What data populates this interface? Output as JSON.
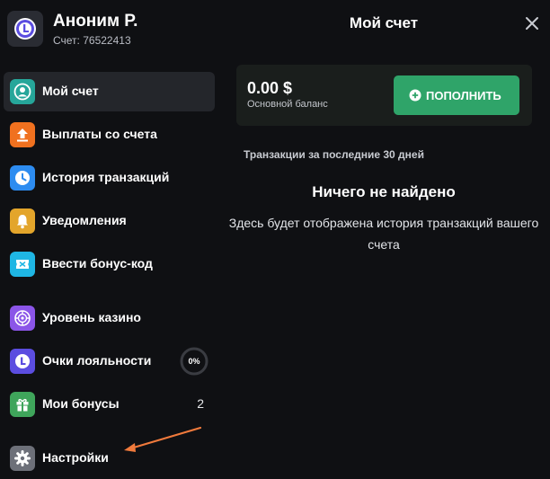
{
  "profile": {
    "name": "Аноним Р.",
    "account_label": "Счет: 76522413"
  },
  "sidebar": {
    "items": [
      {
        "label": "Мой счет",
        "icon": "user-circle-icon",
        "active": true,
        "color": "#26a69a"
      },
      {
        "label": "Выплаты со счета",
        "icon": "upload-icon",
        "color": "#f0711f"
      },
      {
        "label": "История транзакций",
        "icon": "clock-icon",
        "color": "#2d8cf0"
      },
      {
        "label": "Уведомления",
        "icon": "bell-icon",
        "color": "#e3a52b"
      },
      {
        "label": "Ввести бонус-код",
        "icon": "ticket-icon",
        "color": "#1fb6e4"
      },
      {
        "label": "Уровень казино",
        "icon": "roulette-icon",
        "color": "#8b55e8"
      },
      {
        "label": "Очки лояльности",
        "icon": "loyalty-icon",
        "color": "#5b4de0",
        "progress_text": "0%",
        "progress": 0
      },
      {
        "label": "Мои бонусы",
        "icon": "gift-icon",
        "color": "#3fa55b",
        "badge": "2"
      },
      {
        "label": "Настройки",
        "icon": "gear-icon",
        "color": "#6d7079"
      }
    ]
  },
  "main": {
    "title": "Мой счет",
    "balance": {
      "amount": "0.00 $",
      "label": "Основной баланс",
      "button_label": "ПОПОЛНИТЬ"
    },
    "transactions_period": "Транзакции за последние 30 дней",
    "empty_title": "Ничего не найдено",
    "empty_description": "Здесь будет отображена история транзакций вашего счета"
  },
  "colors": {
    "background": "#0f1013",
    "accent_green": "#2fa469",
    "annotation_arrow": "#f07a3c"
  }
}
